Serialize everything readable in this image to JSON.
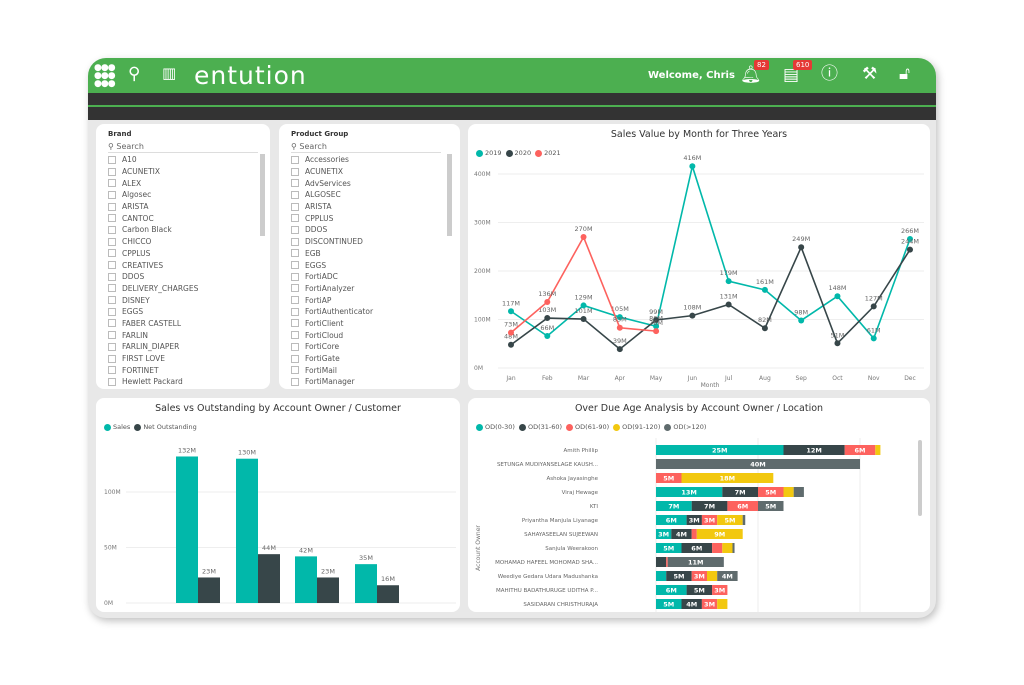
{
  "header": {
    "logo": "entution",
    "welcome": "Welcome, Chris",
    "notifications_count": "82",
    "tasks_count": "610",
    "accent": "#4caf50",
    "icons": [
      "apps-grid-icon",
      "search-icon",
      "map-icon",
      "bell-icon",
      "clipboard-icon",
      "info-icon",
      "tools-icon",
      "unlock-icon"
    ]
  },
  "brand_slicer": {
    "title": "Brand",
    "search_placeholder": "Search",
    "items": [
      "A10",
      "ACUNETIX",
      "ALEX",
      "Algosec",
      "ARISTA",
      "CANTOC",
      "Carbon Black",
      "CHICCO",
      "CPPLUS",
      "CREATIVES",
      "DDOS",
      "DELIVERY_CHARGES",
      "DISNEY",
      "EGGS",
      "FABER CASTELL",
      "FARLIN",
      "FARLIN_DIAPER",
      "FIRST LOVE",
      "FORTINET",
      "Hewlett Packard"
    ]
  },
  "product_slicer": {
    "title": "Product Group",
    "search_placeholder": "Search",
    "items": [
      "Accessories",
      "ACUNETIX",
      "AdvServices",
      "ALGOSEC",
      "ARISTA",
      "CPPLUS",
      "DDOS",
      "DISCONTINUED",
      "EGB",
      "EGGS",
      "FortiADC",
      "FortiAnalyzer",
      "FortiAP",
      "FortiAuthenticator",
      "FortiClient",
      "FortiCloud",
      "FortiCore",
      "FortiGate",
      "FortiMail",
      "FortiManager"
    ]
  },
  "chart_data": [
    {
      "type": "line",
      "title": "Sales Value by Month for Three Years",
      "xlabel": "Month",
      "ylabel": "",
      "categories": [
        "Jan",
        "Feb",
        "Mar",
        "Apr",
        "May",
        "Jun",
        "Jul",
        "Aug",
        "Sep",
        "Oct",
        "Nov",
        "Dec"
      ],
      "yticks": [
        "0M",
        "100M",
        "200M",
        "300M",
        "400M"
      ],
      "ylim": [
        0,
        400
      ],
      "grid": true,
      "legend": "top-left",
      "series": [
        {
          "name": "2019",
          "color": "#01b8aa",
          "values": [
            117,
            66,
            129,
            105,
            86,
            416,
            179,
            161,
            98,
            148,
            61,
            266
          ]
        },
        {
          "name": "2020",
          "color": "#374649",
          "values": [
            48,
            103,
            101,
            39,
            99,
            108,
            131,
            82,
            249,
            51,
            127,
            244
          ]
        },
        {
          "name": "2021",
          "color": "#fd625e",
          "values": [
            73,
            136,
            270,
            83,
            76,
            null,
            null,
            null,
            null,
            null,
            null,
            null
          ]
        }
      ]
    },
    {
      "type": "bar",
      "title": "Sales vs Outstanding by Account Owner / Customer",
      "categories": [
        "",
        "",
        "",
        ""
      ],
      "yticks": [
        "0M",
        "50M",
        "100M"
      ],
      "ylim": [
        0,
        140
      ],
      "grid": true,
      "legend": "top-left",
      "series": [
        {
          "name": "Sales",
          "color": "#01b8aa",
          "values": [
            132,
            130,
            42,
            35
          ]
        },
        {
          "name": "Net Outstanding",
          "color": "#374649",
          "values": [
            23,
            44,
            23,
            16
          ]
        }
      ]
    },
    {
      "type": "bar",
      "orientation": "horizontal",
      "stacked": true,
      "title": "Over Due Age Analysis  by  Account Owner / Location",
      "ylabel": "Account Owner",
      "legend": "top-left",
      "series": [
        {
          "name": "OD(0-30)",
          "color": "#01b8aa"
        },
        {
          "name": "OD(31-60)",
          "color": "#374649"
        },
        {
          "name": "OD(61-90)",
          "color": "#fd625e"
        },
        {
          "name": "OD(91-120)",
          "color": "#f2c80f"
        },
        {
          "name": "OD(>120)",
          "color": "#5f6b6d"
        }
      ],
      "categories": [
        "Amith Phillip",
        "SETUNGA MUDIYANSELAGE KAUSH...",
        "Ashoka Jayasinghe",
        "Viraj Hewage",
        "KTI",
        "Priyantha Manjula Liyanage",
        "SAHAYASEELAN SUJEEWAN",
        "Sanjula Weerakoon",
        "MOHAMAD HAFEEL MOHOMAD SHA...",
        "Weediye Gedara Udara Madushanka",
        "MAHITHU BADATHURUGE UDITHA P...",
        "SASIDARAN CHRISTHURAJA"
      ],
      "values": [
        [
          25,
          12,
          6,
          1,
          0
        ],
        [
          0,
          0,
          0,
          0,
          40
        ],
        [
          0,
          0,
          5,
          18,
          0
        ],
        [
          13,
          7,
          5,
          2,
          2
        ],
        [
          7,
          7,
          6,
          0,
          5
        ],
        [
          6,
          3,
          3,
          5,
          0.5
        ],
        [
          3,
          4,
          1,
          9,
          0
        ],
        [
          5,
          6,
          2,
          2,
          0.4
        ],
        [
          0,
          2,
          0.3,
          0,
          11
        ],
        [
          2,
          5,
          3,
          2,
          4
        ],
        [
          6,
          5,
          3,
          0,
          0
        ],
        [
          5,
          4,
          3,
          2,
          0
        ]
      ]
    }
  ]
}
